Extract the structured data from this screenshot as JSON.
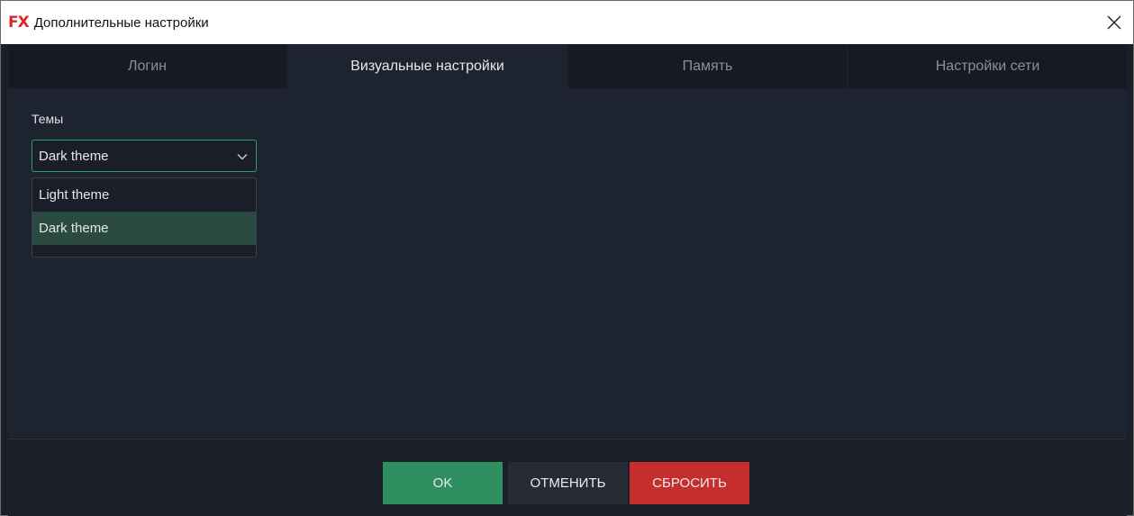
{
  "window": {
    "title": "Дополнительные настройки",
    "logo_f": "F",
    "logo_x": "X"
  },
  "tabs": [
    {
      "label": "Логин",
      "active": false
    },
    {
      "label": "Визуальные настройки",
      "active": true
    },
    {
      "label": "Память",
      "active": false
    },
    {
      "label": "Настройки сети",
      "active": false
    }
  ],
  "themes": {
    "label": "Темы",
    "selected": "Dark theme",
    "options": [
      "Light theme",
      "Dark theme"
    ]
  },
  "footer": {
    "ok_label": "OK",
    "cancel_label": "ОТМЕНИТЬ",
    "reset_label": "СБРОСИТЬ"
  },
  "colors": {
    "accent": "#2f8f60",
    "danger": "#c62e2e",
    "background": "#1e2330"
  },
  "icons": {
    "close": "close-icon",
    "dropdown": "chevron-down-icon"
  }
}
